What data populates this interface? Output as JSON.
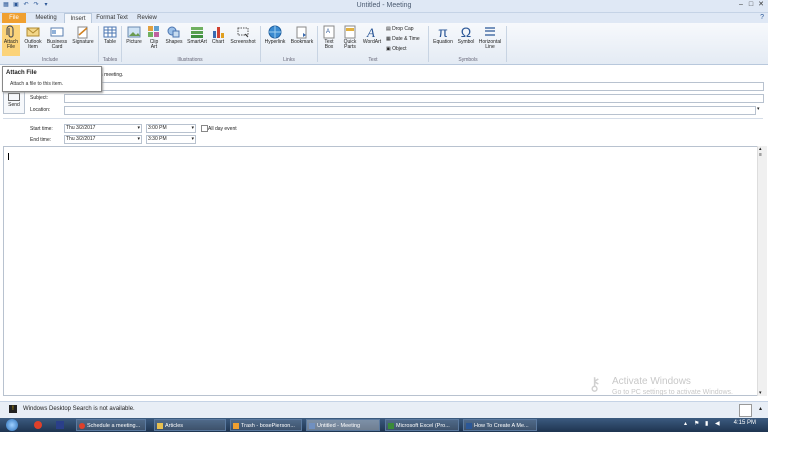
{
  "window": {
    "title": "Untitled - Meeting"
  },
  "tabs": [
    {
      "label": "File"
    },
    {
      "label": "Meeting"
    },
    {
      "label": "Insert"
    },
    {
      "label": "Format Text"
    },
    {
      "label": "Review"
    }
  ],
  "ribbon": {
    "buttons": [
      {
        "line1": "Attach",
        "line2": "File",
        "icon": "paperclip-icon"
      },
      {
        "line1": "Outlook",
        "line2": "Item",
        "icon": "envelope-icon"
      },
      {
        "line1": "Business",
        "line2": "Card",
        "icon": "business-card-icon"
      },
      {
        "line1": "Signature",
        "line2": "",
        "icon": "signature-icon"
      },
      {
        "line1": "Table",
        "line2": "",
        "icon": "table-icon"
      },
      {
        "line1": "Picture",
        "line2": "",
        "icon": "picture-icon"
      },
      {
        "line1": "Clip",
        "line2": "Art",
        "icon": "clip-art-icon"
      },
      {
        "line1": "Shapes",
        "line2": "",
        "icon": "shapes-icon"
      },
      {
        "line1": "SmartArt",
        "line2": "",
        "icon": "smartart-icon"
      },
      {
        "line1": "Chart",
        "line2": "",
        "icon": "chart-icon"
      },
      {
        "line1": "Screenshot",
        "line2": "",
        "icon": "screenshot-icon"
      },
      {
        "line1": "Hyperlink",
        "line2": "",
        "icon": "globe-icon"
      },
      {
        "line1": "Bookmark",
        "line2": "",
        "icon": "bookmark-icon"
      },
      {
        "line1": "Text",
        "line2": "Box",
        "icon": "text-box-icon"
      },
      {
        "line1": "Quick",
        "line2": "Parts",
        "icon": "quick-parts-icon"
      },
      {
        "line1": "WordArt",
        "line2": "",
        "icon": "wordart-icon"
      },
      {
        "line1": "Equation",
        "line2": "",
        "icon": "pi-icon"
      },
      {
        "line1": "Symbol",
        "line2": "",
        "icon": "omega-icon"
      },
      {
        "line1": "Horizontal",
        "line2": "Line",
        "icon": "horizontal-line-icon"
      }
    ],
    "small_buttons": [
      "Drop Cap",
      "Date & Time",
      "Object"
    ],
    "groups": [
      "Include",
      "Tables",
      "Illustrations",
      "Links",
      "Text",
      "Symbols"
    ]
  },
  "tooltip": {
    "title": "Attach File",
    "description": "Attach a file to this item."
  },
  "form": {
    "invite_text": "a meeting.",
    "send_label": "Send",
    "subject_label": "Subject:",
    "location_label": "Location:",
    "start_label": "Start time:",
    "end_label": "End time:",
    "start_date": "Thu 3/2/2017",
    "start_time": "3:00 PM",
    "end_date": "Thu 3/2/2017",
    "end_time": "3:30 PM",
    "all_day_label": "All day event"
  },
  "watermark": {
    "line1": "Activate Windows",
    "line2": "Go to PC settings to activate Windows."
  },
  "status": {
    "message": "Windows Desktop Search is not available."
  },
  "taskbar": {
    "items": [
      {
        "label": "Schedule a meeting...",
        "icon": "chrome-icon"
      },
      {
        "label": "Articles",
        "icon": "folder-icon"
      },
      {
        "label": "Trash - bosePierson...",
        "icon": "outlook-icon"
      },
      {
        "label": "Untitled - Meeting",
        "icon": "meeting-icon"
      },
      {
        "label": "Microsoft Excel (Pro...",
        "icon": "excel-icon"
      },
      {
        "label": "How To Create A Me...",
        "icon": "word-icon"
      }
    ],
    "clock": "4:15 PM"
  }
}
